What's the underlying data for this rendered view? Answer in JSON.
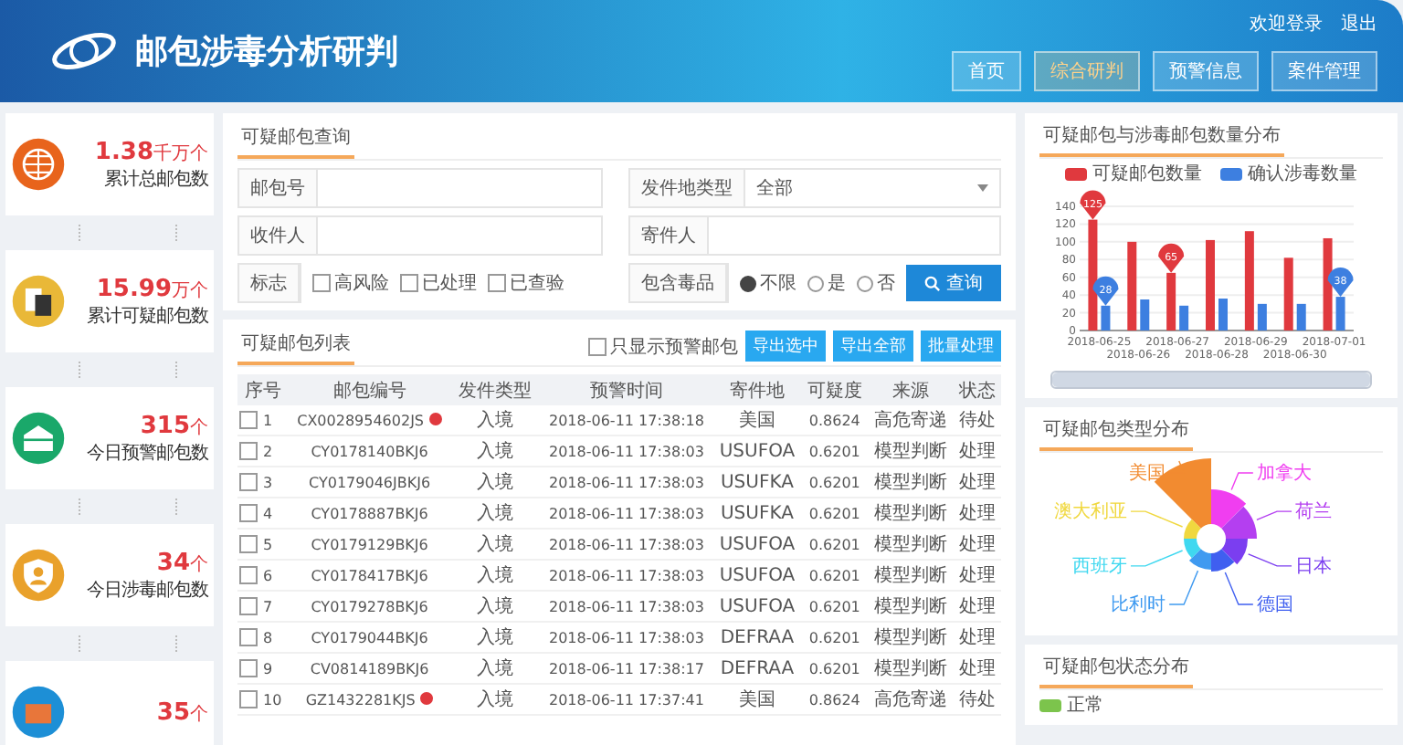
{
  "header": {
    "title": "邮包涉毒分析研判",
    "links": [
      "欢迎登录",
      "退出"
    ],
    "nav": [
      {
        "label": "首页",
        "selected": false
      },
      {
        "label": "综合研判",
        "selected": true
      },
      {
        "label": "预警信息",
        "selected": false
      },
      {
        "label": "案件管理",
        "selected": false
      }
    ]
  },
  "stats": [
    {
      "kind": "globe",
      "color": "#e8641c",
      "value": "1.38",
      "unit": "千万个",
      "label": "累计总邮包数"
    },
    {
      "kind": "document",
      "color": "#e9b838",
      "value": "15.99",
      "unit": "万个",
      "label": "累计可疑邮包数"
    },
    {
      "kind": "tray",
      "color": "#1aa86a",
      "value": "315",
      "unit": "个",
      "label": "今日预警邮包数"
    },
    {
      "kind": "shield",
      "color": "#e9a12b",
      "value": "34",
      "unit": "个",
      "label": "今日涉毒邮包数"
    },
    {
      "kind": "box",
      "color": "#1d8fd6",
      "value": "35",
      "unit": "个"
    }
  ],
  "search": {
    "title": "可疑邮包查询",
    "fields": [
      {
        "kind": "text",
        "label": "邮包号"
      },
      {
        "kind": "select",
        "label": "发件地类型",
        "value": "全部"
      },
      {
        "kind": "text",
        "label": "收件人"
      },
      {
        "kind": "text",
        "label": "寄件人"
      }
    ],
    "flags": {
      "label": "标志",
      "options": [
        {
          "label": "高风险",
          "checked": false
        },
        {
          "label": "已处理",
          "checked": false
        },
        {
          "label": "已查验",
          "checked": false
        }
      ]
    },
    "drug": {
      "label": "包含毒品",
      "options": [
        {
          "label": "不限",
          "selected": true
        },
        {
          "label": "是",
          "selected": false
        },
        {
          "label": "否",
          "selected": false
        }
      ]
    },
    "button": "查询"
  },
  "table": {
    "title": "可疑邮包列表",
    "filter": {
      "label": "只显示预警邮包",
      "checked": false
    },
    "actions": [
      "导出选中",
      "导出全部",
      "批量处理"
    ],
    "columns": [
      "序号",
      "邮包编号",
      "发件类型",
      "预警时间",
      "寄件地",
      "可疑度",
      "来源",
      "状态"
    ],
    "rows": [
      {
        "checked": false,
        "alert": true,
        "cells": [
          "1",
          "CX0028954602JS",
          "入境",
          "2018-06-11 17:38:18",
          "美国",
          "0.8624",
          "高危寄递",
          "待处"
        ]
      },
      {
        "checked": false,
        "alert": false,
        "cells": [
          "2",
          "CY0178140BKJ6",
          "入境",
          "2018-06-11 17:38:03",
          "USUFOA",
          "0.6201",
          "模型判断",
          "处理"
        ]
      },
      {
        "checked": false,
        "alert": false,
        "cells": [
          "3",
          "CY0179046JBKJ6",
          "入境",
          "2018-06-11 17:38:03",
          "USUFKA",
          "0.6201",
          "模型判断",
          "处理"
        ]
      },
      {
        "checked": false,
        "alert": false,
        "cells": [
          "4",
          "CY0178887BKJ6",
          "入境",
          "2018-06-11 17:38:03",
          "USUFKA",
          "0.6201",
          "模型判断",
          "处理"
        ]
      },
      {
        "checked": false,
        "alert": false,
        "cells": [
          "5",
          "CY0179129BKJ6",
          "入境",
          "2018-06-11 17:38:03",
          "USUFOA",
          "0.6201",
          "模型判断",
          "处理"
        ]
      },
      {
        "checked": false,
        "alert": false,
        "cells": [
          "6",
          "CY0178417BKJ6",
          "入境",
          "2018-06-11 17:38:03",
          "USUFOA",
          "0.6201",
          "模型判断",
          "处理"
        ]
      },
      {
        "checked": false,
        "alert": false,
        "cells": [
          "7",
          "CY0179278BKJ6",
          "入境",
          "2018-06-11 17:38:03",
          "USUFOA",
          "0.6201",
          "模型判断",
          "处理"
        ]
      },
      {
        "checked": false,
        "alert": false,
        "cells": [
          "8",
          "CY0179044BKJ6",
          "入境",
          "2018-06-11 17:38:03",
          "DEFRAA",
          "0.6201",
          "模型判断",
          "处理"
        ]
      },
      {
        "checked": false,
        "alert": false,
        "cells": [
          "9",
          "CV0814189BKJ6",
          "入境",
          "2018-06-11 17:38:17",
          "DEFRAA",
          "0.6201",
          "模型判断",
          "处理"
        ]
      },
      {
        "checked": false,
        "alert": true,
        "cells": [
          "10",
          "GZ1432281KJS",
          "入境",
          "2018-06-11 17:37:41",
          "美国",
          "0.8624",
          "高危寄递",
          "待处"
        ]
      }
    ]
  },
  "trend": {
    "title": "可疑邮包与涉毒邮包数量分布",
    "chart_data": {
      "type": "bar",
      "categories": [
        "2018-06-25",
        "2018-06-26",
        "2018-06-27",
        "2018-06-28",
        "2018-06-29",
        "2018-06-30",
        "2018-07-01"
      ],
      "series": [
        {
          "name": "可疑邮包数量",
          "color": "#e0393e",
          "values": [
            125,
            100,
            65,
            102,
            112,
            82,
            104
          ]
        },
        {
          "name": "确认涉毒数量",
          "color": "#3d7fe0",
          "values": [
            28,
            35,
            28,
            36,
            30,
            30,
            38
          ]
        }
      ],
      "yticks": [
        0,
        20,
        40,
        60,
        80,
        100,
        120,
        140
      ],
      "ylim": [
        0,
        140
      ],
      "grid": true,
      "annotations": [
        {
          "x": "2018-06-25",
          "y": 125,
          "text": "125"
        },
        {
          "x": "2018-06-25",
          "y": 28,
          "text": "28"
        },
        {
          "x": "2018-06-27",
          "y": 65,
          "text": "65"
        },
        {
          "x": "2018-07-01",
          "y": 38,
          "text": "38"
        }
      ]
    },
    "zoom": {
      "level": 1
    }
  },
  "types": {
    "title": "可疑邮包类型分布",
    "items": [
      {
        "label": "美国",
        "color": "#f28b30"
      },
      {
        "label": "加拿大",
        "color": "#f03ef0"
      },
      {
        "label": "荷兰",
        "color": "#b43ff0"
      },
      {
        "label": "日本",
        "color": "#7b3ef0"
      },
      {
        "label": "德国",
        "color": "#3f5ff0"
      },
      {
        "label": "比利时",
        "color": "#3f9af0"
      },
      {
        "label": "西班牙",
        "color": "#3fd8f0"
      },
      {
        "label": "澳大利亚",
        "color": "#f0d83f"
      }
    ]
  },
  "status": {
    "title": "可疑邮包状态分布",
    "legend": [
      {
        "label": "正常",
        "color": "#7cc44c"
      }
    ]
  }
}
